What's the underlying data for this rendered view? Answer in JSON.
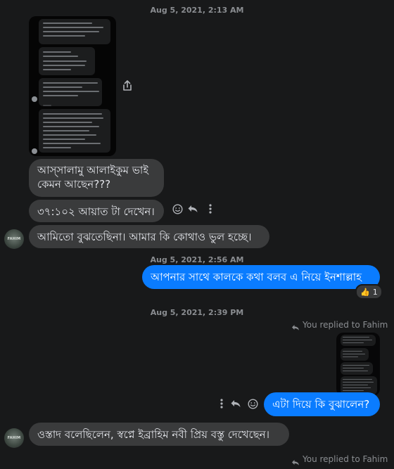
{
  "timestamps": [
    "Aug 5, 2021, 2:13 AM",
    "Aug 5, 2021, 2:56 AM",
    "Aug 5, 2021, 2:39 PM"
  ],
  "messages": {
    "m1_line1": "আস্‌সালামু আলাইকুম ভাই",
    "m1_line2": "কেমন আছেন???",
    "m2": "৩৭:১০২ আয়াত টা দেখেন।",
    "m3": "আমিতো বুঝতেছিনা। আমার কি কোথাও ভুল হচ্ছে।",
    "m4": "আপনার সাথে কালকে কথা বলব এ নিয়ে ইনশাল্লাহ",
    "m5": "এটা দিয়ে কি বুঝালেন?",
    "m6": "ওস্তাদ বলেছিলেন, স্বপ্নে ইব্রাহিম নবী প্রিয় বস্তু দেখেছেন।"
  },
  "reactions": {
    "m4": {
      "emoji": "👍",
      "count": "1"
    }
  },
  "reply_notes": {
    "first": "You replied to Fahim",
    "second": "You replied to Fahim"
  },
  "avatar": {
    "label": "FAHIM"
  },
  "icons": [
    "share-icon",
    "emoji-icon",
    "reply-icon",
    "more-icon",
    "reply-arrow-icon"
  ],
  "colors": {
    "background": "#18191a",
    "incoming": "#3a3b3c",
    "outgoing": "#0a7cff",
    "meta": "#8a8d91"
  }
}
